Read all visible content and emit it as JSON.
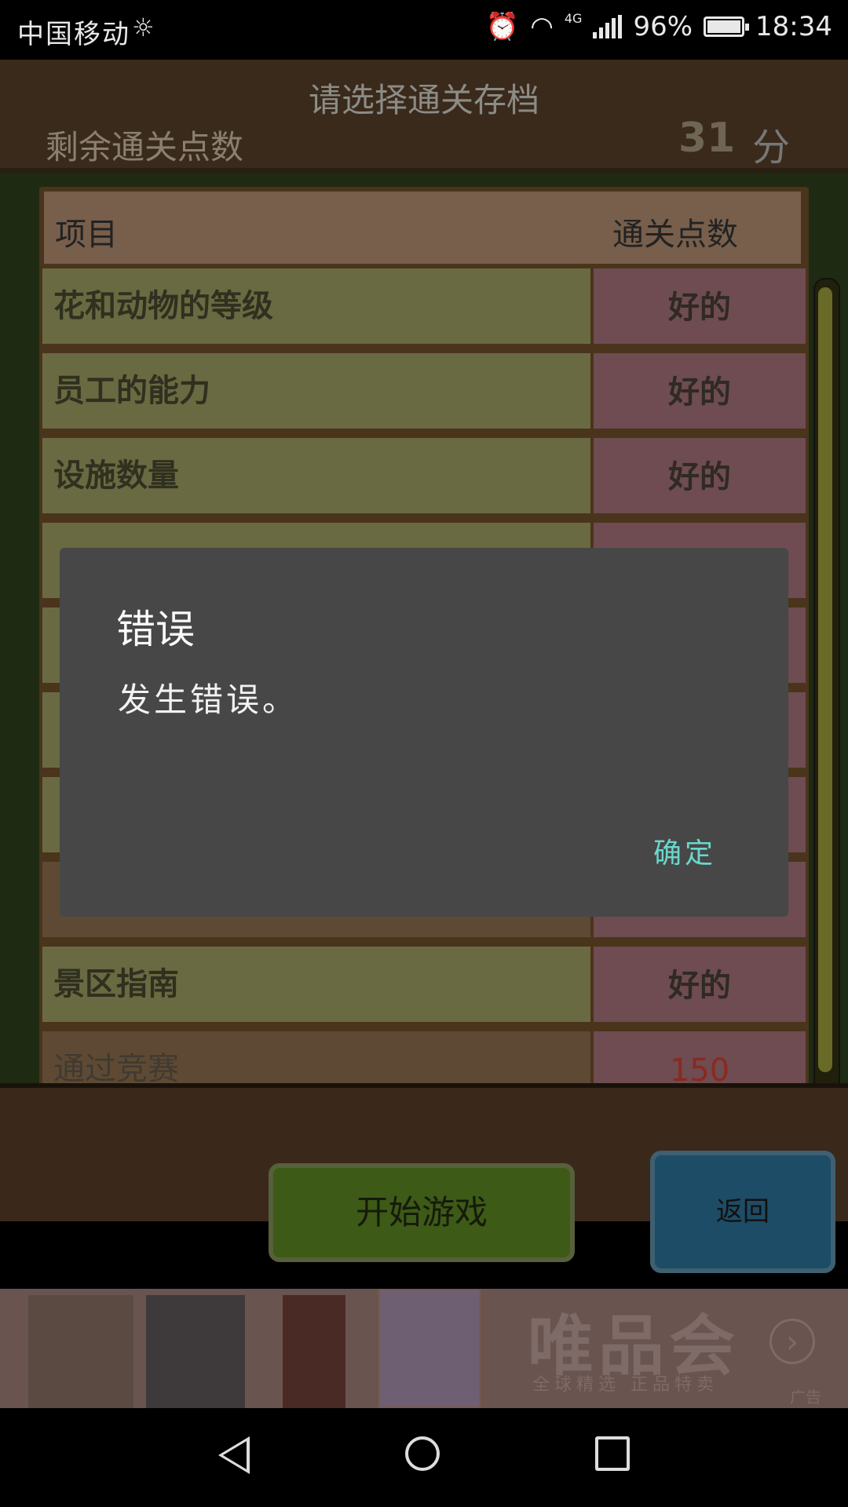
{
  "status_bar": {
    "carrier": "中国移动",
    "network": "4G",
    "battery": "96%",
    "time": "18:34"
  },
  "header": {
    "title": "请选择通关存档",
    "points_label": "剩余通关点数",
    "points_value": "31",
    "points_unit": "分"
  },
  "table": {
    "col_item": "项目",
    "col_points": "通关点数",
    "rows": [
      {
        "name": "花和动物的等级",
        "value": "好的"
      },
      {
        "name": "员工的能力",
        "value": "好的"
      },
      {
        "name": "设施数量",
        "value": "好的"
      },
      {
        "name": "",
        "value": ""
      },
      {
        "name": "",
        "value": ""
      },
      {
        "name": "",
        "value": ""
      },
      {
        "name": "",
        "value": ""
      },
      {
        "name": "",
        "value": ""
      },
      {
        "name": "景区指南",
        "value": "好的"
      },
      {
        "name": "通过竞赛",
        "value": "150"
      }
    ]
  },
  "buttons": {
    "start": "开始游戏",
    "back": "返回"
  },
  "ad": {
    "brand": "唯品会",
    "tagline": "全球精选  正品特卖",
    "label": "广告"
  },
  "dialog": {
    "title": "错误",
    "message": "发生错误。",
    "ok": "确定"
  },
  "colors": {
    "dialog_bg": "#474747",
    "dialog_ok": "#6ad7cc",
    "highlight_value_red": "#8a2a1e"
  }
}
